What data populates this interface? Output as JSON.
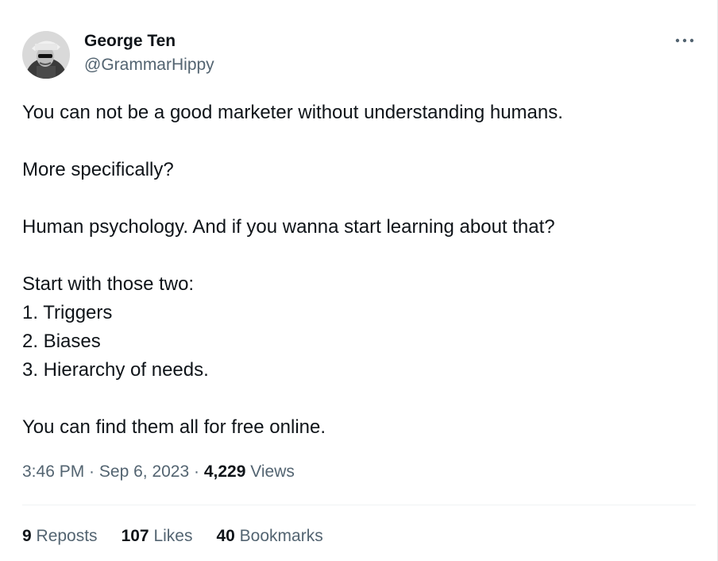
{
  "author": {
    "name": "George Ten",
    "handle": "@GrammarHippy",
    "avatar": "avatar-image"
  },
  "menu": {
    "icon": "more-horizontal-icon"
  },
  "tweet": {
    "lines": [
      "You can not be a good marketer without understanding humans.",
      "",
      "More specifically?",
      "",
      "Human psychology. And if you wanna start learning about that?",
      "",
      "Start with those two:",
      "1. Triggers",
      "2. Biases",
      "3. Hierarchy of needs.",
      "",
      "You can find them all for free online."
    ]
  },
  "meta": {
    "time": "3:46 PM",
    "separator": " · ",
    "date": "Sep 6, 2023",
    "views_count": "4,229",
    "views_label": " Views"
  },
  "stats": {
    "reposts_count": "9",
    "reposts_label": " Reposts",
    "likes_count": "107",
    "likes_label": " Likes",
    "bookmarks_count": "40",
    "bookmarks_label": " Bookmarks"
  },
  "colors": {
    "text": "#0f1419",
    "secondary": "#536471",
    "divider": "#eff3f4"
  }
}
